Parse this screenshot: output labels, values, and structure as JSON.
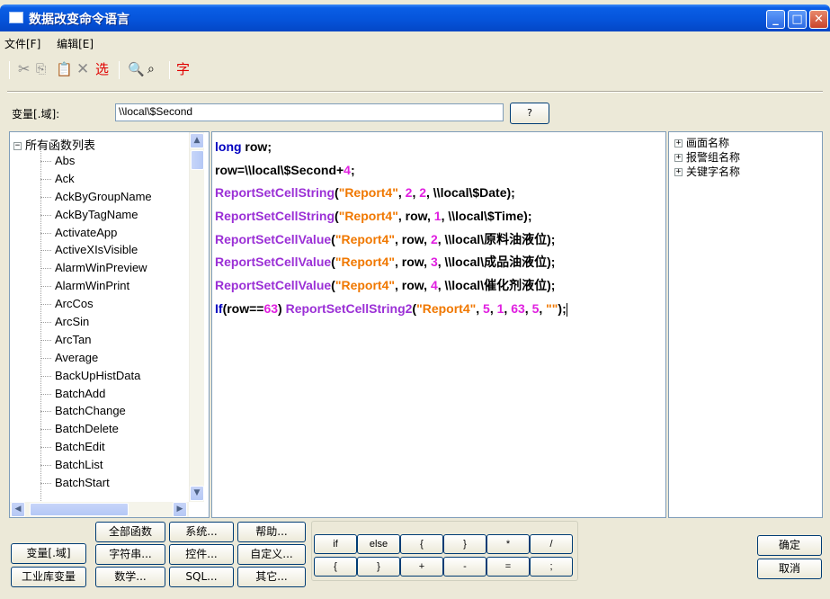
{
  "window": {
    "title": "数据改变命令语言"
  },
  "menu": [
    "文件[F]",
    "编辑[E]"
  ],
  "toolbar": {
    "select_label": "选",
    "font_label": "字"
  },
  "variable": {
    "label": "变量[.域]:",
    "value": "\\\\local\\$Second",
    "help_label": "?"
  },
  "function_tree": {
    "root": "所有函数列表",
    "items": [
      "Abs",
      "Ack",
      "AckByGroupName",
      "AckByTagName",
      "ActivateApp",
      "ActiveXIsVisible",
      "AlarmWinPreview",
      "AlarmWinPrint",
      "ArcCos",
      "ArcSin",
      "ArcTan",
      "Average",
      "BackUpHistData",
      "BatchAdd",
      "BatchChange",
      "BatchDelete",
      "BatchEdit",
      "BatchList",
      "BatchStart"
    ]
  },
  "code_lines": [
    [
      {
        "t": "long",
        "c": "kw"
      },
      {
        "t": " row;",
        "c": ""
      }
    ],
    [
      {
        "t": "row=\\\\local\\$Second+",
        "c": ""
      },
      {
        "t": "4",
        "c": "num"
      },
      {
        "t": ";",
        "c": ""
      }
    ],
    [
      {
        "t": "ReportSetCellString",
        "c": "fn"
      },
      {
        "t": "(",
        "c": ""
      },
      {
        "t": "\"Report4\"",
        "c": "str"
      },
      {
        "t": ", ",
        "c": ""
      },
      {
        "t": "2",
        "c": "num"
      },
      {
        "t": ", ",
        "c": ""
      },
      {
        "t": "2",
        "c": "num"
      },
      {
        "t": ", \\\\local\\$Date);",
        "c": ""
      }
    ],
    [
      {
        "t": "ReportSetCellString",
        "c": "fn"
      },
      {
        "t": "(",
        "c": ""
      },
      {
        "t": "\"Report4\"",
        "c": "str"
      },
      {
        "t": ", row, ",
        "c": ""
      },
      {
        "t": "1",
        "c": "num"
      },
      {
        "t": ", \\\\local\\$Time);",
        "c": ""
      }
    ],
    [
      {
        "t": "ReportSetCellValue",
        "c": "fn"
      },
      {
        "t": "(",
        "c": ""
      },
      {
        "t": "\"Report4\"",
        "c": "str"
      },
      {
        "t": ", row, ",
        "c": ""
      },
      {
        "t": "2",
        "c": "num"
      },
      {
        "t": ", \\\\local\\原料油液位);",
        "c": ""
      }
    ],
    [
      {
        "t": "ReportSetCellValue",
        "c": "fn"
      },
      {
        "t": "(",
        "c": ""
      },
      {
        "t": "\"Report4\"",
        "c": "str"
      },
      {
        "t": ", row, ",
        "c": ""
      },
      {
        "t": "3",
        "c": "num"
      },
      {
        "t": ", \\\\local\\成品油液位);",
        "c": ""
      }
    ],
    [
      {
        "t": "ReportSetCellValue",
        "c": "fn"
      },
      {
        "t": "(",
        "c": ""
      },
      {
        "t": "\"Report4\"",
        "c": "str"
      },
      {
        "t": ", row, ",
        "c": ""
      },
      {
        "t": "4",
        "c": "num"
      },
      {
        "t": ", \\\\local\\催化剂液位);",
        "c": ""
      }
    ],
    [
      {
        "t": "If",
        "c": "kw"
      },
      {
        "t": "(row==",
        "c": ""
      },
      {
        "t": "63",
        "c": "num"
      },
      {
        "t": ") ",
        "c": ""
      },
      {
        "t": "ReportSetCellString2",
        "c": "fn"
      },
      {
        "t": "(",
        "c": ""
      },
      {
        "t": "\"Report4\"",
        "c": "str"
      },
      {
        "t": ", ",
        "c": ""
      },
      {
        "t": "5",
        "c": "num"
      },
      {
        "t": ", ",
        "c": ""
      },
      {
        "t": "1",
        "c": "num"
      },
      {
        "t": ", ",
        "c": ""
      },
      {
        "t": "63",
        "c": "num"
      },
      {
        "t": ", ",
        "c": ""
      },
      {
        "t": "5",
        "c": "num"
      },
      {
        "t": ", ",
        "c": ""
      },
      {
        "t": "\"\"",
        "c": "str"
      },
      {
        "t": ");",
        "c": ""
      }
    ]
  ],
  "right_tree": [
    "画面名称",
    "报警组名称",
    "关键字名称"
  ],
  "bottom": {
    "var_domain": "变量[.域]",
    "industrial_vars": "工业库变量",
    "all_functions": "全部函数",
    "system": "系统...",
    "help": "帮助...",
    "string": "字符串...",
    "control": "控件...",
    "custom": "自定义...",
    "math": "数学...",
    "sql": "SQL...",
    "other": "其它..."
  },
  "operators_row1": [
    "if",
    "else",
    "{",
    "}",
    "*",
    "/"
  ],
  "operators_row2": [
    "{",
    "}",
    "+",
    "-",
    "=",
    ";"
  ],
  "dialog": {
    "ok": "确定",
    "cancel": "取消"
  }
}
